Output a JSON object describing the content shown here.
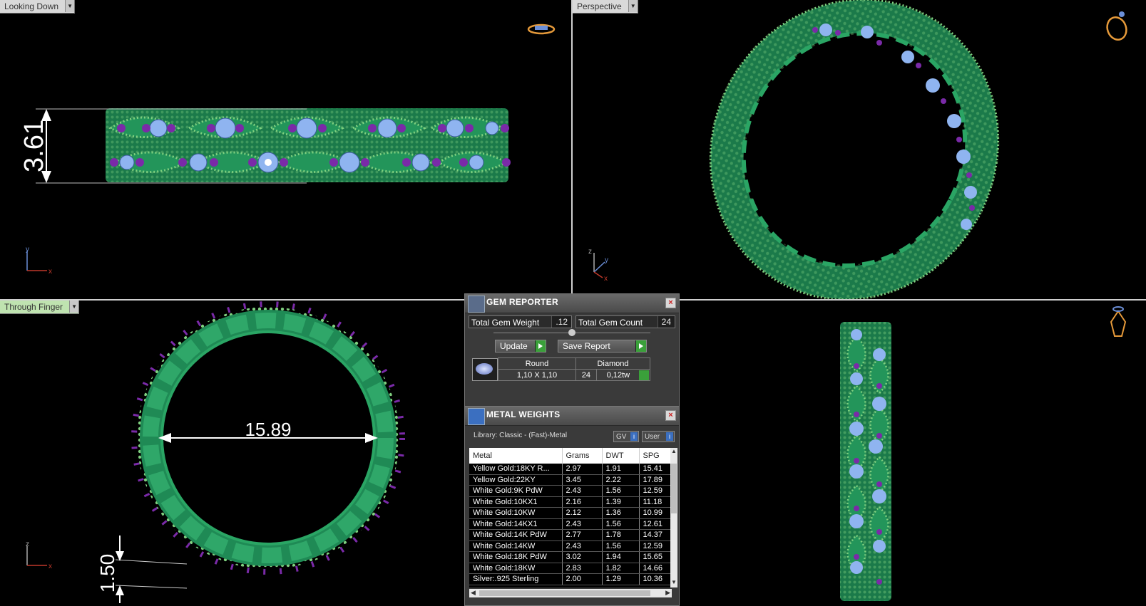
{
  "viewports": {
    "top_left": {
      "label": "Looking Down",
      "dimension": "3.61",
      "axis_y": "y",
      "axis_x": "x"
    },
    "top_right": {
      "label": "Perspective",
      "axis_z": "z",
      "axis_y": "y",
      "axis_x": "x"
    },
    "bottom_left": {
      "label": "Through Finger",
      "dimension_inner": "15.89",
      "dimension_thickness": "1.50",
      "axis_z": "z",
      "axis_x": "x"
    },
    "bottom_right": {
      "label": ""
    }
  },
  "gem_reporter": {
    "title": "GEM REPORTER",
    "total_gem_weight_label": "Total Gem Weight",
    "total_gem_weight": ".12",
    "total_gem_count_label": "Total Gem Count",
    "total_gem_count": "24",
    "update_label": "Update",
    "save_report_label": "Save Report",
    "gem": {
      "shape": "Round",
      "type": "Diamond",
      "size": "1,10 X 1,10",
      "count": "24",
      "weight": "0,12tw"
    }
  },
  "metal_weights": {
    "title": "METAL WEIGHTS",
    "library": "Library: Classic - (Fast)-Metal",
    "toggle_gv": "GV",
    "toggle_user": "User",
    "columns": [
      "Metal",
      "Grams",
      "DWT",
      "SPG"
    ],
    "rows": [
      [
        "Yellow Gold:18KY R...",
        "2.97",
        "1.91",
        "15.41"
      ],
      [
        "Yellow Gold:22KY",
        "3.45",
        "2.22",
        "17.89"
      ],
      [
        "White Gold:9K PdW",
        "2.43",
        "1.56",
        "12.59"
      ],
      [
        "White Gold:10KX1",
        "2.16",
        "1.39",
        "11.18"
      ],
      [
        "White Gold:10KW",
        "2.12",
        "1.36",
        "10.99"
      ],
      [
        "White Gold:14KX1",
        "2.43",
        "1.56",
        "12.61"
      ],
      [
        "White Gold:14K PdW",
        "2.77",
        "1.78",
        "14.37"
      ],
      [
        "White Gold:14KW",
        "2.43",
        "1.56",
        "12.59"
      ],
      [
        "White Gold:18K PdW",
        "3.02",
        "1.94",
        "15.65"
      ],
      [
        "White Gold:18KW",
        "2.83",
        "1.82",
        "14.66"
      ],
      [
        "Silver:.925 Sterling",
        "2.00",
        "1.29",
        "10.36"
      ]
    ]
  },
  "colors": {
    "metal": "#1f8a55",
    "gem": "#8fb4f0",
    "prong": "#7a2aa8",
    "beads": "#7fd07f"
  }
}
